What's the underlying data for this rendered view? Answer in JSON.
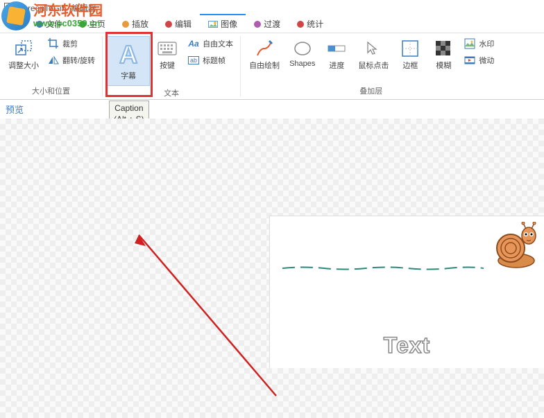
{
  "window": {
    "title": "ScreenToGif - 编辑器"
  },
  "watermark": {
    "cn": "河东软件园",
    "url": "www.pc0359.cn"
  },
  "menu": {
    "file": "文件",
    "home": "主页",
    "playback": "插放",
    "edit": "编辑",
    "image": "图像",
    "transition": "过渡",
    "stats": "统计"
  },
  "ribbon": {
    "resize": "调整大小",
    "crop": "裁剪",
    "flip_rotate": "翻转/旋转",
    "group_size": "大小和位置",
    "caption": "字幕",
    "keys": "按键",
    "free_text": "自由文本",
    "title_frame": "标题帧",
    "group_text": "文本",
    "free_draw": "自由绘制",
    "shapes": "Shapes",
    "progress": "进度",
    "mouse_clicks": "鼠标点击",
    "border": "边框",
    "obfuscate": "模糊",
    "watermark": "水印",
    "cinemagraph": "微动",
    "group_overlay": "叠加层"
  },
  "tooltip": {
    "line1": "Caption",
    "line2": "(Alt + S)"
  },
  "preview": {
    "label": "预览",
    "canvas_text": "Text"
  },
  "colors": {
    "blue": "#3b7bbf",
    "green": "#3aa63a",
    "orange": "#e89a3c",
    "red": "#d04545",
    "purple": "#b05ab0"
  }
}
